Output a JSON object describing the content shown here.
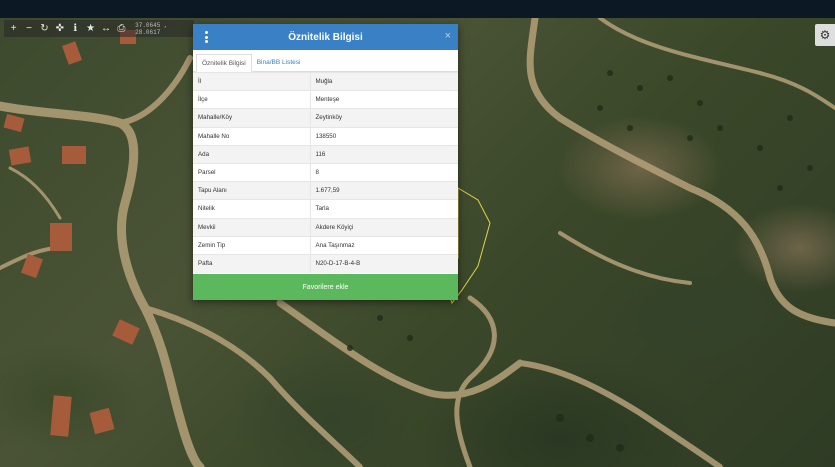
{
  "toolbar": {
    "buttons": [
      {
        "name": "zoom-in-icon",
        "glyph": "+"
      },
      {
        "name": "zoom-out-icon",
        "glyph": "−"
      },
      {
        "name": "refresh-icon",
        "glyph": "↻"
      },
      {
        "name": "locate-icon",
        "glyph": "✜"
      },
      {
        "name": "info-icon",
        "glyph": "ℹ"
      },
      {
        "name": "star-icon",
        "glyph": "★"
      },
      {
        "name": "measure-icon",
        "glyph": "↔"
      },
      {
        "name": "print-icon",
        "glyph": "⎙"
      }
    ],
    "coords": "37.0645 , 28.0617"
  },
  "settings_icon": "gear-icon",
  "dialog": {
    "title": "Öznitelik Bilgisi",
    "close": "×",
    "tabs": [
      {
        "label": "Öznitelik Bilgisi",
        "active": true
      },
      {
        "label": "Bina/BB Listesi",
        "active": false
      }
    ],
    "rows": [
      {
        "key": "İl",
        "value": "Muğla"
      },
      {
        "key": "İlçe",
        "value": "Menteşe"
      },
      {
        "key": "Mahalle/Köy",
        "value": "Zeytinköy"
      },
      {
        "key": "Mahalle No",
        "value": "138550"
      },
      {
        "key": "Ada",
        "value": "116"
      },
      {
        "key": "Parsel",
        "value": "8"
      },
      {
        "key": "Tapu Alanı",
        "value": "1.677,59"
      },
      {
        "key": "Nitelik",
        "value": "Tarla"
      },
      {
        "key": "Mevkii",
        "value": "Akdere Köyiçi"
      },
      {
        "key": "Zemin Tip",
        "value": "Ana Taşınmaz"
      },
      {
        "key": "Pafta",
        "value": "N20-D-17-B-4-B"
      }
    ],
    "favorite_button": "Favorilere ekle"
  },
  "colors": {
    "header": "#3a80c4",
    "button": "#5cb85c",
    "parcel_outline": "#e4d34a"
  }
}
